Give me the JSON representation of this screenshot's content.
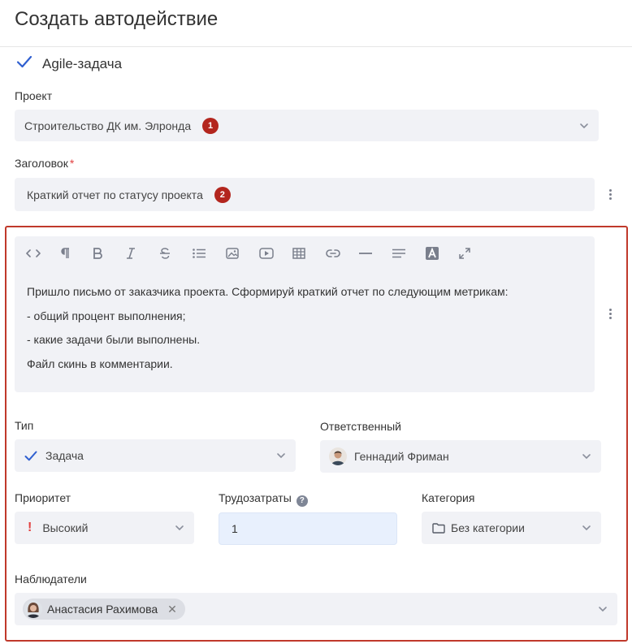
{
  "page": {
    "title": "Создать автодействие"
  },
  "action_type": {
    "label": "Agile-задача"
  },
  "project": {
    "label": "Проект",
    "value": "Строительство ДК им. Элронда",
    "badge": "1"
  },
  "heading": {
    "label": "Заголовок",
    "required_mark": "*",
    "value": "Краткий отчет по статусу проекта",
    "badge": "2"
  },
  "editor": {
    "toolbar": [
      "code-icon",
      "paragraph-icon",
      "bold-icon",
      "italic-icon",
      "strikethrough-icon",
      "bullet-list-icon",
      "image-icon",
      "video-icon",
      "table-icon",
      "link-icon",
      "horizontal-rule-icon",
      "align-icon",
      "text-color-icon",
      "fullscreen-icon"
    ],
    "lines": [
      "Пришло письмо от заказчика проекта. Сформируй краткий отчет по следующим метрикам:",
      "- общий процент выполнения;",
      "- какие задачи были выполнены.",
      "Файл скинь в комментарии."
    ]
  },
  "type": {
    "label": "Тип",
    "value": "Задача"
  },
  "assignee": {
    "label": "Ответственный",
    "value": "Геннадий Фриман"
  },
  "priority": {
    "label": "Приоритет",
    "value": "Высокий"
  },
  "effort": {
    "label": "Трудозатраты",
    "help": "?",
    "value": "1"
  },
  "category": {
    "label": "Категория",
    "value": "Без категории"
  },
  "watchers": {
    "label": "Наблюдатели",
    "items": [
      {
        "name": "Анастасия Рахимова",
        "remove": "✕"
      }
    ]
  },
  "colors": {
    "accent": "#2f5fd0",
    "badge": "#b3261e",
    "frame": "#c0392b",
    "field_bg": "#f1f2f6",
    "priority": "#e24040"
  }
}
